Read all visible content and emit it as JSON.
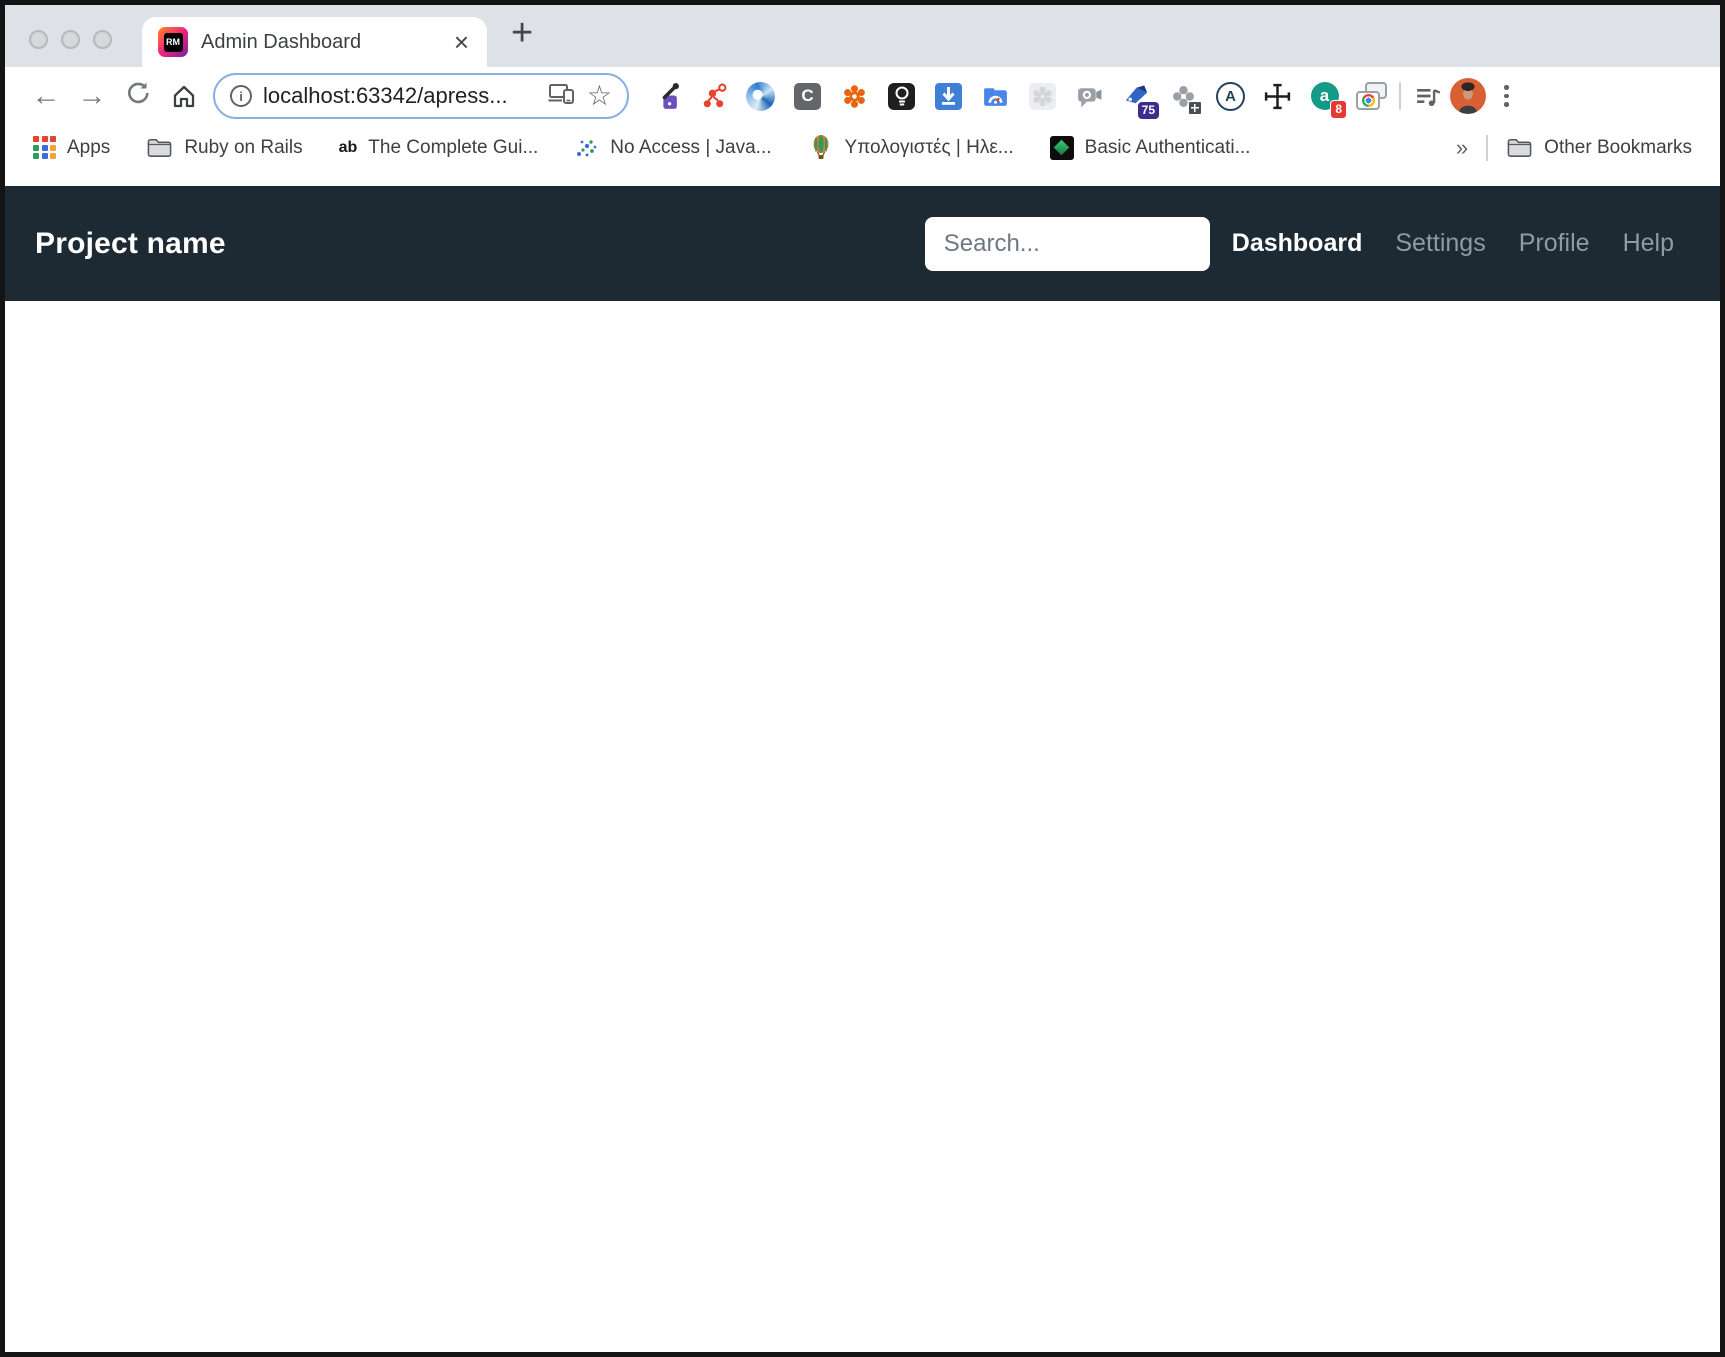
{
  "browser": {
    "tab": {
      "title": "Admin Dashboard",
      "close_glyph": "×"
    },
    "new_tab_glyph": "+",
    "favicon_text": "RM",
    "address": {
      "url": "localhost:63342/apress..."
    },
    "extension_letters": {
      "c": "C",
      "a_circle": "A",
      "a_teal": "a"
    },
    "extension_badges": {
      "key_badge": "75",
      "a_badge": "8"
    },
    "bookmarks": {
      "ab_glyph": "ab",
      "items": [
        {
          "label": "Apps",
          "icon": "apps-grid"
        },
        {
          "label": "Ruby on Rails",
          "icon": "folder"
        },
        {
          "label": "The Complete Gui...",
          "icon": "ab"
        },
        {
          "label": "No Access | Java...",
          "icon": "scatter-dots"
        },
        {
          "label": "Υπολογιστές | Ηλε...",
          "icon": "balloon"
        },
        {
          "label": "Basic Authenticati...",
          "icon": "green-diamond"
        }
      ],
      "overflow_glyph": "»",
      "other_bookmarks_label": "Other Bookmarks"
    },
    "nav_glyphs": {
      "back": "←",
      "forward": "→",
      "home": "⌂",
      "star": "☆",
      "info": "i"
    }
  },
  "page": {
    "navbar": {
      "brand": "Project name",
      "search_placeholder": "Search...",
      "links": [
        {
          "label": "Dashboard",
          "active": true
        },
        {
          "label": "Settings",
          "active": false
        },
        {
          "label": "Profile",
          "active": false
        },
        {
          "label": "Help",
          "active": false
        }
      ]
    }
  },
  "colors": {
    "navbar_bg": "#1d2933",
    "chrome_bg": "#dee1e6",
    "omnibox_focus_ring": "#8aaede",
    "nav_link_inactive": "#8f9aa3",
    "nav_link_active": "#ffffff"
  }
}
